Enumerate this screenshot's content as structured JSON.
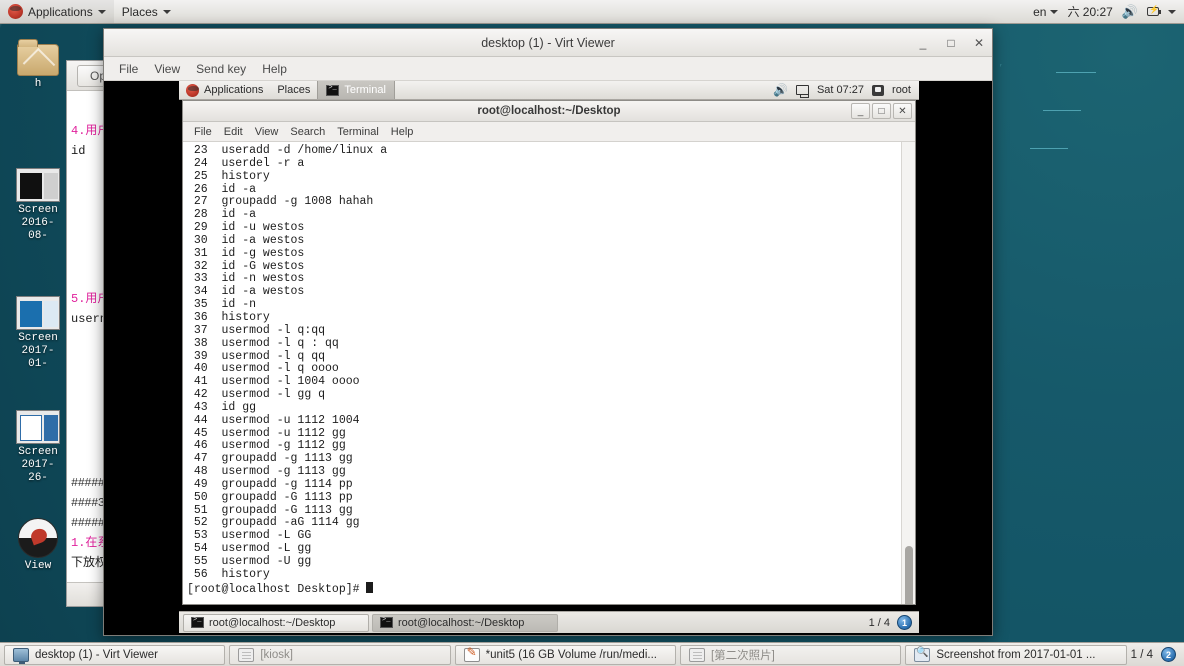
{
  "host_panel": {
    "applications_label": "Applications",
    "places_label": "Places",
    "keyboard_layout": "en",
    "clock": "六 20:27",
    "volume_icon": "speaker-muted-icon",
    "battery_icon": "battery-charging-icon"
  },
  "host_desktop_icons": [
    {
      "name": "home-folder",
      "label": "h",
      "icon": "folder-icon"
    },
    {
      "name": "screenshot-2016-08",
      "label": "Screen\n2016-\n08-",
      "icon": "screenshot-icon"
    },
    {
      "name": "screenshot-2017-01",
      "label": "Screen\n2017-\n01-",
      "icon": "screenshot-icon"
    },
    {
      "name": "screenshot-2017-26",
      "label": "Screen\n2017-\n26-",
      "icon": "screenshot-icon"
    },
    {
      "name": "viewer-app",
      "label": "View",
      "icon": "redhat-ball-icon"
    }
  ],
  "background_window": {
    "open_button_label": "Op",
    "lines": [
      {
        "text": "4.用户",
        "style": "pink"
      },
      {
        "text": "id",
        "style": "plain"
      },
      {
        "text": "5.用户",
        "style": "pink"
      },
      {
        "text": "usern",
        "style": "plain"
      },
      {
        "text": "#####",
        "style": "hashes"
      },
      {
        "text": "####3",
        "style": "hashes"
      },
      {
        "text": "#####",
        "style": "hashes"
      },
      {
        "text": "1.在系",
        "style": "pink"
      },
      {
        "text": "下放权",
        "style": "plain"
      }
    ]
  },
  "virt_viewer": {
    "title": "desktop (1) - Virt Viewer",
    "menu": [
      "File",
      "View",
      "Send key",
      "Help"
    ],
    "window_controls": {
      "minimize": "_",
      "maximize": "□",
      "close": "✕"
    }
  },
  "guest_panel": {
    "applications_label": "Applications",
    "places_label": "Places",
    "active_task_label": "Terminal",
    "clock": "Sat 07:27",
    "user_label": "root",
    "volume_icon": "speaker-icon",
    "network_icon": "network-disconnected-icon",
    "user_icon": "user-icon"
  },
  "guest_terminal": {
    "title": "root@localhost:~/Desktop",
    "menu": [
      "File",
      "Edit",
      "View",
      "Search",
      "Terminal",
      "Help"
    ],
    "window_controls": {
      "minimize": "_",
      "maximize": "□",
      "close": "✕"
    },
    "history": [
      {
        "n": "23",
        "cmd": "useradd -d /home/linux a"
      },
      {
        "n": "24",
        "cmd": "userdel -r a"
      },
      {
        "n": "25",
        "cmd": "history"
      },
      {
        "n": "26",
        "cmd": "id -a"
      },
      {
        "n": "27",
        "cmd": "groupadd -g 1008 hahah"
      },
      {
        "n": "28",
        "cmd": "id -a"
      },
      {
        "n": "29",
        "cmd": "id -u westos"
      },
      {
        "n": "30",
        "cmd": "id -a westos"
      },
      {
        "n": "31",
        "cmd": "id -g westos"
      },
      {
        "n": "32",
        "cmd": "id -G westos"
      },
      {
        "n": "33",
        "cmd": "id -n westos"
      },
      {
        "n": "34",
        "cmd": "id -a westos"
      },
      {
        "n": "35",
        "cmd": "id -n"
      },
      {
        "n": "36",
        "cmd": "history"
      },
      {
        "n": "37",
        "cmd": "usermod -l q:qq"
      },
      {
        "n": "38",
        "cmd": "usermod -l q : qq"
      },
      {
        "n": "39",
        "cmd": "usermod -l q qq"
      },
      {
        "n": "40",
        "cmd": "usermod -l q oooo"
      },
      {
        "n": "41",
        "cmd": "usermod -l 1004 oooo"
      },
      {
        "n": "42",
        "cmd": "usermod -l gg q"
      },
      {
        "n": "43",
        "cmd": "id gg"
      },
      {
        "n": "44",
        "cmd": "usermod -u 1112 1004"
      },
      {
        "n": "45",
        "cmd": "usermod -u 1112 gg"
      },
      {
        "n": "46",
        "cmd": "usermod -g 1112 gg"
      },
      {
        "n": "47",
        "cmd": "groupadd -g 1113 gg"
      },
      {
        "n": "48",
        "cmd": "usermod -g 1113 gg"
      },
      {
        "n": "49",
        "cmd": "groupadd -g 1114 pp"
      },
      {
        "n": "50",
        "cmd": "groupadd -G 1113 pp"
      },
      {
        "n": "51",
        "cmd": "groupadd -G 1113 gg"
      },
      {
        "n": "52",
        "cmd": "groupadd -aG 1114 gg"
      },
      {
        "n": "53",
        "cmd": "usermod -L GG"
      },
      {
        "n": "54",
        "cmd": "usermod -L gg"
      },
      {
        "n": "55",
        "cmd": "usermod -U gg"
      },
      {
        "n": "56",
        "cmd": "history"
      }
    ],
    "prompt": "[root@localhost Desktop]# "
  },
  "guest_taskbar": {
    "tasks": [
      {
        "label": "root@localhost:~/Desktop",
        "active": false
      },
      {
        "label": "root@localhost:~/Desktop",
        "active": true
      }
    ],
    "workspace_indicator": "1 / 4",
    "pager_badge": "1"
  },
  "host_taskbar": {
    "tasks": [
      {
        "label": "desktop (1) - Virt Viewer",
        "icon": "monitor-icon",
        "dim": false
      },
      {
        "label": "[kiosk]",
        "icon": "generic-window-icon",
        "dim": true
      },
      {
        "label": "*unit5 (16 GB Volume /run/medi...",
        "icon": "text-editor-icon",
        "dim": false
      },
      {
        "label": "[第二次照片]",
        "icon": "generic-window-icon",
        "dim": true
      },
      {
        "label": "Screenshot from 2017-01-01 ...",
        "icon": "screenshot-viewer-icon",
        "dim": false
      }
    ],
    "workspace_indicator": "1 / 4",
    "pager_badge": "2"
  }
}
